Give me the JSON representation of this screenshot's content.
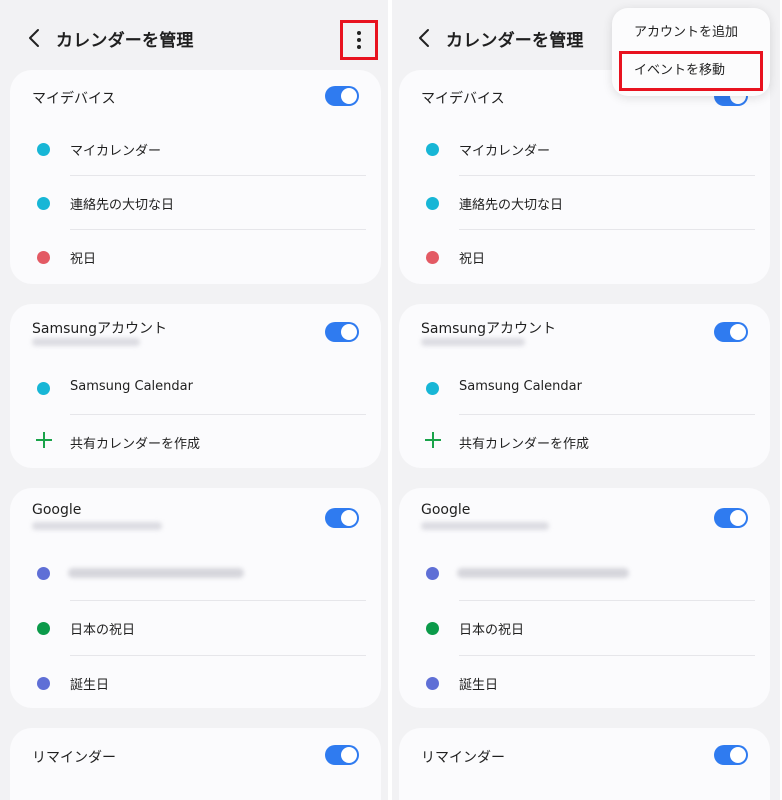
{
  "header": {
    "title": "カレンダーを管理"
  },
  "sections": [
    {
      "name": "マイデバイス",
      "has_account": false,
      "items": [
        {
          "label": "マイカレンダー",
          "color": "#17b6d6"
        },
        {
          "label": "連絡先の大切な日",
          "color": "#17b6d6"
        },
        {
          "label": "祝日",
          "color": "#e35a64"
        }
      ]
    },
    {
      "name": "Samsungアカウント",
      "has_account": true,
      "items": [
        {
          "label": "Samsung Calendar",
          "color": "#17b6d6"
        },
        {
          "label": "共有カレンダーを作成",
          "icon": "plus-icon",
          "color": "#1aa34a"
        }
      ]
    },
    {
      "name": "Google",
      "has_account": true,
      "items": [
        {
          "label": "",
          "blurred": true,
          "color": "#5f6fd6"
        },
        {
          "label": "日本の祝日",
          "color": "#0b9a4a"
        },
        {
          "label": "誕生日",
          "color": "#5f6fd6"
        }
      ]
    },
    {
      "name": "リマインダー",
      "has_account": false,
      "items": []
    }
  ],
  "menu": {
    "items": [
      {
        "label": "アカウントを追加"
      },
      {
        "label": "イベントを移動"
      }
    ]
  },
  "colors": {
    "accent": "#2f7bf0",
    "highlight": "#e8121f"
  }
}
